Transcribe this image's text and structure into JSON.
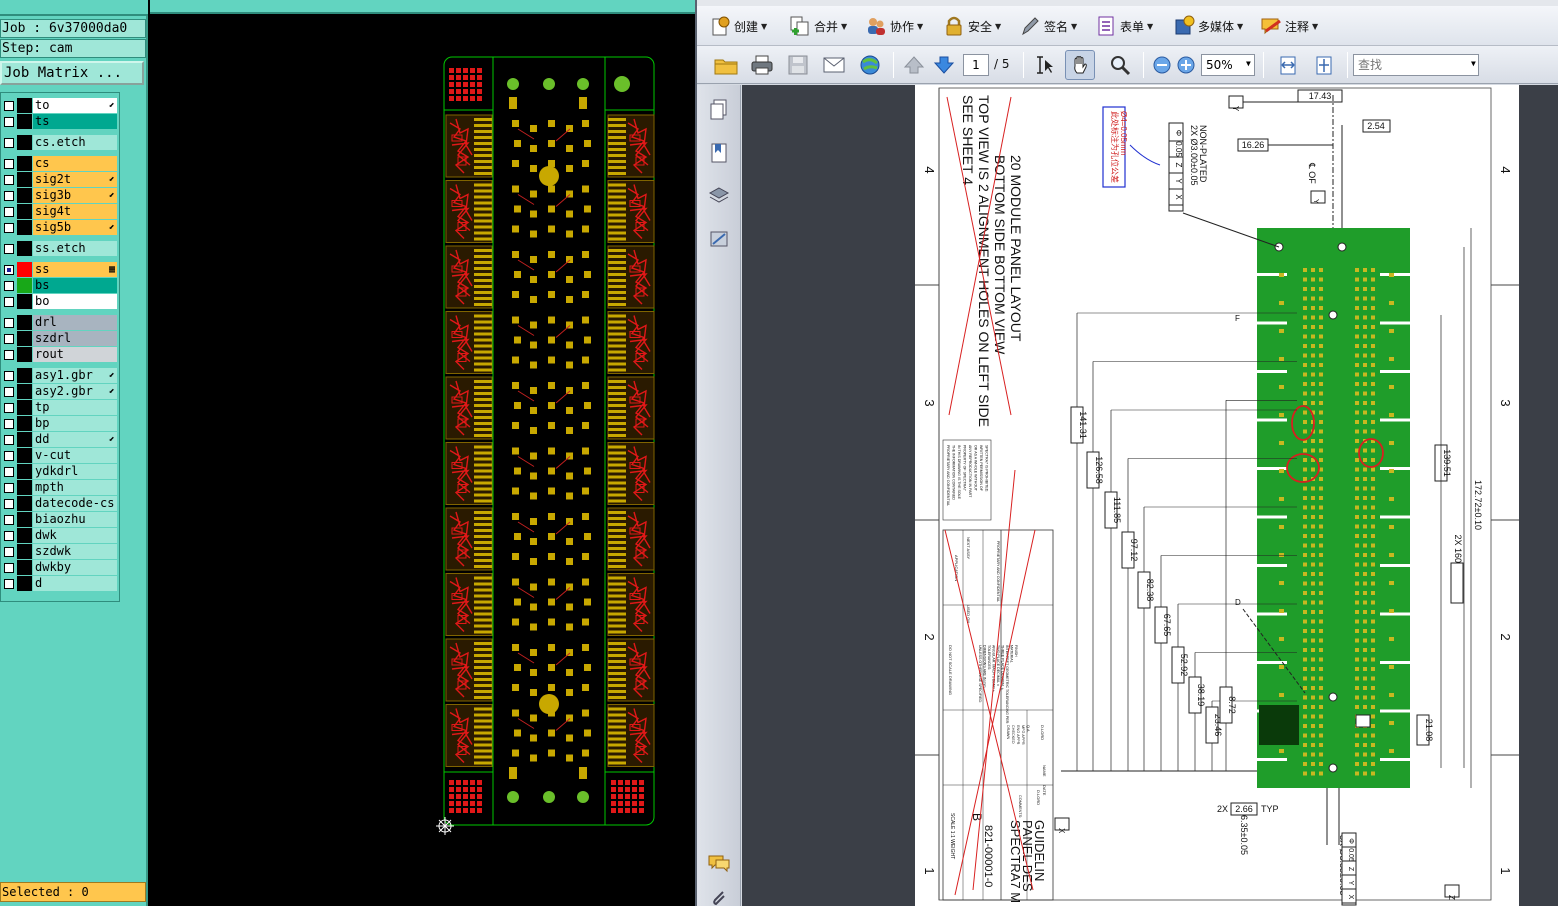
{
  "cam": {
    "job_line": "Job : 6v37000da0",
    "step_line": "Step: cam",
    "job_matrix_label": "Job Matrix ...",
    "selected_line": "Selected : 0",
    "colors": {
      "panel": "#62d4c0",
      "board_outline": "#00c800",
      "copper": "#c8a800",
      "trace": "#e01818",
      "canvas": "#000000"
    },
    "layers": [
      {
        "name": "to",
        "color": "#ffffff",
        "swatch": "#000000",
        "mark": "⬋",
        "group": 0
      },
      {
        "name": "ts",
        "color": "#00a890",
        "swatch": "#000000",
        "mark": "",
        "group": 0
      },
      {
        "name": "cs.etch",
        "color": "#9fe7d8",
        "swatch": "#000000",
        "mark": "",
        "group": 1
      },
      {
        "name": "cs",
        "color": "#ffc64d",
        "swatch": "#000000",
        "mark": "",
        "group": 2
      },
      {
        "name": "sig2t",
        "color": "#ffc64d",
        "swatch": "#000000",
        "mark": "⬋",
        "group": 2
      },
      {
        "name": "sig3b",
        "color": "#ffc64d",
        "swatch": "#000000",
        "mark": "⬋",
        "group": 2
      },
      {
        "name": "sig4t",
        "color": "#ffc64d",
        "swatch": "#000000",
        "mark": "",
        "group": 2
      },
      {
        "name": "sig5b",
        "color": "#ffc64d",
        "swatch": "#000000",
        "mark": "⬋",
        "group": 2
      },
      {
        "name": "ss.etch",
        "color": "#9fe7d8",
        "swatch": "#000000",
        "mark": "",
        "group": 3
      },
      {
        "name": "ss",
        "color": "#ffc64d",
        "swatch": "#ff0000",
        "mark": "▦",
        "group": 4,
        "active": true
      },
      {
        "name": "bs",
        "color": "#00a890",
        "swatch": "#18a818",
        "mark": "",
        "group": 4
      },
      {
        "name": "bo",
        "color": "#ffffff",
        "swatch": "#000000",
        "mark": "",
        "group": 4
      },
      {
        "name": "drl",
        "color": "#a8b4c0",
        "swatch": "#000000",
        "mark": "",
        "group": 5
      },
      {
        "name": "szdrl",
        "color": "#a8b4c0",
        "swatch": "#000000",
        "mark": "",
        "group": 5
      },
      {
        "name": "rout",
        "color": "#d0d4d8",
        "swatch": "#000000",
        "mark": "",
        "group": 5
      },
      {
        "name": "asy1.gbr",
        "color": "#9fe7d8",
        "swatch": "#000000",
        "mark": "⬋",
        "group": 6
      },
      {
        "name": "asy2.gbr",
        "color": "#9fe7d8",
        "swatch": "#000000",
        "mark": "⬋",
        "group": 6
      },
      {
        "name": "tp",
        "color": "#9fe7d8",
        "swatch": "#000000",
        "mark": "",
        "group": 6
      },
      {
        "name": "bp",
        "color": "#9fe7d8",
        "swatch": "#000000",
        "mark": "",
        "group": 6
      },
      {
        "name": "dd",
        "color": "#9fe7d8",
        "swatch": "#000000",
        "mark": "⬋",
        "group": 6
      },
      {
        "name": "v-cut",
        "color": "#9fe7d8",
        "swatch": "#000000",
        "mark": "",
        "group": 6
      },
      {
        "name": "ydkdrl",
        "color": "#9fe7d8",
        "swatch": "#000000",
        "mark": "",
        "group": 6
      },
      {
        "name": "mpth",
        "color": "#9fe7d8",
        "swatch": "#000000",
        "mark": "",
        "group": 6
      },
      {
        "name": "datecode-cs",
        "color": "#9fe7d8",
        "swatch": "#000000",
        "mark": "",
        "group": 6
      },
      {
        "name": "biaozhu",
        "color": "#9fe7d8",
        "swatch": "#000000",
        "mark": "",
        "group": 6
      },
      {
        "name": "dwk",
        "color": "#9fe7d8",
        "swatch": "#000000",
        "mark": "",
        "group": 6
      },
      {
        "name": "szdwk",
        "color": "#9fe7d8",
        "swatch": "#000000",
        "mark": "",
        "group": 6
      },
      {
        "name": "dwkby",
        "color": "#9fe7d8",
        "swatch": "#000000",
        "mark": "",
        "group": 6
      },
      {
        "name": "d",
        "color": "#9fe7d8",
        "swatch": "#000000",
        "mark": "",
        "group": 6
      }
    ]
  },
  "acrobat": {
    "toolbar1": [
      {
        "label": "创建",
        "icon": "create-icon"
      },
      {
        "label": "合并",
        "icon": "combine-icon"
      },
      {
        "label": "协作",
        "icon": "collaborate-icon"
      },
      {
        "label": "安全",
        "icon": "lock-icon"
      },
      {
        "label": "签名",
        "icon": "pen-icon"
      },
      {
        "label": "表单",
        "icon": "form-icon"
      },
      {
        "label": "多媒体",
        "icon": "multimedia-icon"
      },
      {
        "label": "注释",
        "icon": "comment-icon"
      }
    ],
    "page_current": "1",
    "page_total": "/ 5",
    "zoom": "50%",
    "search_placeholder": "查找",
    "colors": {
      "toolbar": "#e4e8ee",
      "doc_bg": "#3b3f47",
      "pcb_green": "#1f9d2a",
      "annotation_red": "#d82020",
      "callout_blue": "#2030d0"
    }
  },
  "drawing": {
    "titles": [
      "20 MODULE PANEL LAYOUT",
      "BOTTOM SIDE BOTTOM VIEW",
      "TOP VIEW IS 2 ALIGNMENT HOLES ON LEFT SIDE",
      "SEE SHEET 4"
    ],
    "zone_numbers": [
      "4",
      "3",
      "2",
      "1"
    ],
    "dims_top": [
      "17.43",
      "2.54",
      "16.26"
    ],
    "hole_callout_top": [
      "2X Ø3.00±0.05",
      "NON-PLATED"
    ],
    "fcf_top": [
      "Φ",
      "0.05",
      "Z",
      "Y",
      "X"
    ],
    "datum_labels": [
      "Y",
      "X",
      "Z",
      "D",
      "F"
    ],
    "centerline_label": "℄ OF",
    "dims_left": [
      "141.31",
      "126.58",
      "111.85",
      "97.12",
      "82.38",
      "67.65",
      "52.92",
      "38.19",
      "23.46",
      "8.72"
    ],
    "dims_right": [
      "139.51",
      "2X 160.02",
      "172.72±0.10",
      "21.08"
    ],
    "dims_bottom": [
      "2X",
      "2.66",
      "TYP",
      "6.35±0.05"
    ],
    "hole_callout_bottom": [
      "3X Ø3.35±0.05"
    ],
    "fcf_bottom": [
      "Φ",
      "0.05",
      "Z",
      "Y",
      "X"
    ],
    "chinese_note": [
      "此处标注为孔位公差",
      "Ø4=0.05mm"
    ],
    "title_block": [
      "SPECTRA7 M",
      "PANEL DES",
      "GUIDELIN",
      "B",
      "821-00001-0",
      "SCALE 1:1  WEIGHT"
    ],
    "tb_small": [
      "DO NOT SCALE DRAWING",
      "UNLESS OTHERWISE SPECIFIED:",
      "DIMENSIONS ARE IN mm",
      "TOLERANCES:",
      "ANGULAR: MACH ±  BEND ±",
      "TWO PLACE DECIMAL ±",
      "THREE PLACE DECIMAL ±",
      "INTERPRET GEOMETRIC TOLERANCING PER:",
      "MATERIAL",
      "FINISH",
      "NEXT ASSY",
      "USED ON",
      "APPLICATION",
      "NAME",
      "DATE",
      "DRAWN",
      "CHECKED",
      "ENG APPR",
      "MFG APPR",
      "Q.A.",
      "COMMENTS:",
      "D.LORD",
      "PROPRIETARY AND CONFIDENTIAL"
    ]
  }
}
